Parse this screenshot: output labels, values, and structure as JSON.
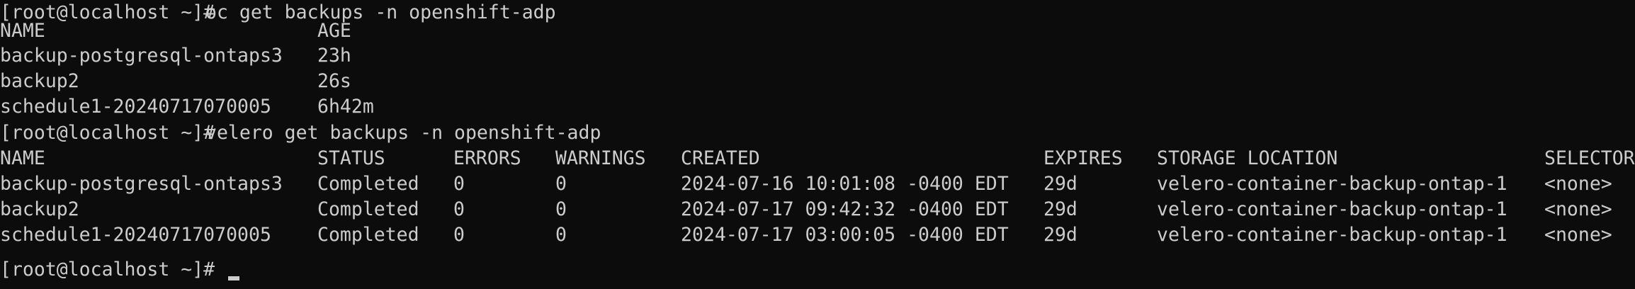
{
  "terminal": {
    "cmd1": {
      "prompt": "[root@localhost ~]#",
      "command": "oc get backups -n openshift-adp"
    },
    "oc_table": {
      "headers": [
        "NAME",
        "AGE"
      ],
      "rows": [
        [
          "backup-postgresql-ontaps3",
          "23h"
        ],
        [
          "backup2",
          "26s"
        ],
        [
          "schedule1-20240717070005",
          "6h42m"
        ]
      ]
    },
    "cmd2": {
      "prompt": "[root@localhost ~]#",
      "command": "velero get backups -n openshift-adp"
    },
    "velero_table": {
      "headers": [
        "NAME",
        "STATUS",
        "ERRORS",
        "WARNINGS",
        "CREATED",
        "EXPIRES",
        "STORAGE LOCATION",
        "SELECTOR"
      ],
      "rows": [
        [
          "backup-postgresql-ontaps3",
          "Completed",
          "0",
          "0",
          "2024-07-16 10:01:08 -0400 EDT",
          "29d",
          "velero-container-backup-ontap-1",
          "<none>"
        ],
        [
          "backup2",
          "Completed",
          "0",
          "0",
          "2024-07-17 09:42:32 -0400 EDT",
          "29d",
          "velero-container-backup-ontap-1",
          "<none>"
        ],
        [
          "schedule1-20240717070005",
          "Completed",
          "0",
          "0",
          "2024-07-17 03:00:05 -0400 EDT",
          "29d",
          "velero-container-backup-ontap-1",
          "<none>"
        ]
      ]
    },
    "cmd3": {
      "prompt": "[root@localhost ~]#"
    },
    "colors": {
      "background": "#0c0c0c",
      "foreground": "#cccccc"
    }
  }
}
